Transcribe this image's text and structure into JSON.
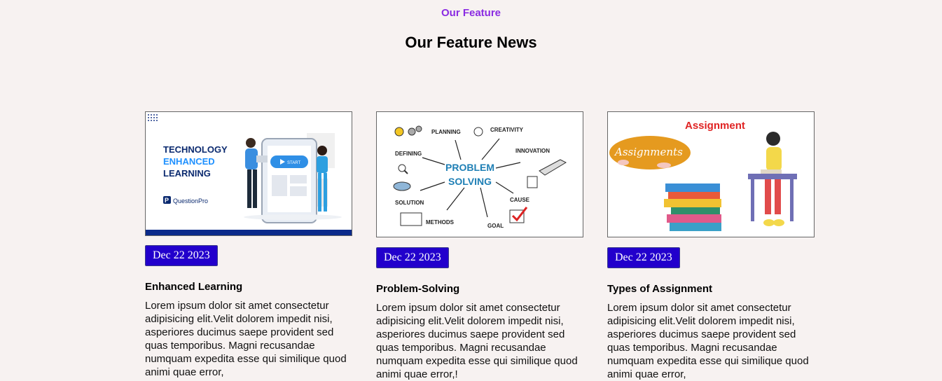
{
  "section": {
    "eyebrow": "Our Feature",
    "title": "Our Feature News"
  },
  "cards": [
    {
      "image_alt": "Technology Enhanced Learning",
      "image_text": {
        "line1": "TECHNOLOGY",
        "line2": "ENHANCED",
        "line3": "LEARNING",
        "brand": "QuestionPro",
        "button": "START"
      },
      "date": "Dec 22 2023",
      "title": "Enhanced Learning",
      "text": "Lorem ipsum dolor sit amet consectetur adipisicing elit.Velit dolorem impedit nisi, asperiores ducimus saepe provident sed quas temporibus. Magni recusandae numquam expedita esse qui similique quod animi quae error,"
    },
    {
      "image_alt": "Problem Solving",
      "image_text": {
        "center1": "PROBLEM",
        "center2": "SOLVING",
        "planning": "PLANNING",
        "creativity": "CREATIVITY",
        "defining": "DEFINING",
        "innovation": "INNOVATION",
        "solution": "SOLUTION",
        "cause": "CAUSE",
        "methods": "METHODS",
        "goal": "GOAL"
      },
      "date": "Dec 22 2023",
      "title": "Problem-Solving",
      "text": "Lorem ipsum dolor sit amet consectetur adipisicing elit.Velit dolorem impedit nisi, asperiores ducimus saepe provident sed quas temporibus. Magni recusandae numquam expedita esse qui similique quod animi quae error,!"
    },
    {
      "image_alt": "Assignment",
      "image_text": {
        "title": "Assignment",
        "oval": "Assignments"
      },
      "date": "Dec 22 2023",
      "title": "Types of Assignment",
      "text": "Lorem ipsum dolor sit amet consectetur adipisicing elit.Velit dolorem impedit nisi, asperiores ducimus saepe provident sed quas temporibus. Magni recusandae numquam expedita esse qui similique quod animi quae error,"
    }
  ],
  "colors": {
    "background": "#f7f2f1",
    "eyebrow": "#8a2be2",
    "badge": "#2200cc"
  }
}
